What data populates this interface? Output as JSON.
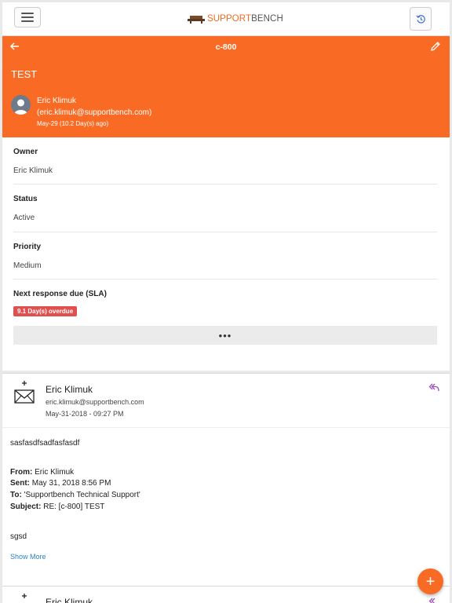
{
  "topbar": {
    "logo_part1": "SUPPORT",
    "logo_part2": "BENCH",
    "menu_icon": "hamburger-icon",
    "history_icon": "history-icon"
  },
  "header": {
    "ticket_id": "c-800",
    "title": "TEST",
    "requester_name": "Eric Klimuk",
    "requester_email": "(eric.klimuk@supportbench.com)",
    "created": "May-29  (10.2 Day(s) ago)",
    "accent_color": "#f96b24"
  },
  "details": {
    "owner_label": "Owner",
    "owner_value": "Eric Klimuk",
    "status_label": "Status",
    "status_value": "Active",
    "priority_label": "Priority",
    "priority_value": "Medium",
    "sla_label": "Next response due (SLA)",
    "sla_badge": "9.1 Day(s) overdue",
    "more": "•••"
  },
  "message": {
    "sender": "Eric Klimuk",
    "email": "eric.klimuk@supportbench.com",
    "time": "May-31-2018 - 09:27 PM",
    "line1": "sasfasdfsadfasfasdf",
    "from_label": "From:",
    "from_value": " Eric Klimuk",
    "sent_label": "Sent:",
    "sent_value": " May 31, 2018 8:56 PM",
    "to_label": "To:",
    "to_value": " 'Supportbench Technical Support'",
    "subject_label": "Subject:",
    "subject_value": " RE: [c-800] TEST",
    "line2": "sgsd",
    "show_more": "Show More"
  },
  "message2": {
    "sender": "Eric Klimuk"
  },
  "fab": "+"
}
